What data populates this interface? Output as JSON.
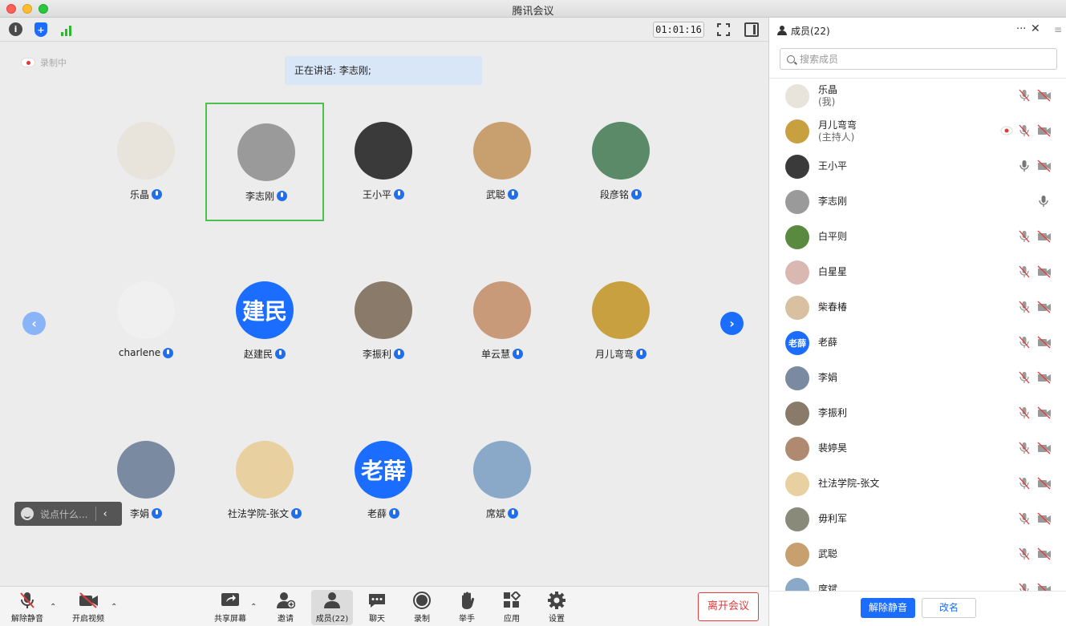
{
  "window": {
    "title": "腾讯会议"
  },
  "toolbar": {
    "timer": "01:01:16"
  },
  "recording": {
    "label": "录制中"
  },
  "speaking": {
    "text": "正在讲话: 李志刚;"
  },
  "grid": {
    "tiles": [
      {
        "name": "乐晶",
        "avatar_color": "#e8e4dc",
        "initials": ""
      },
      {
        "name": "李志刚",
        "avatar_color": "#9a9a9a",
        "initials": "",
        "active": true
      },
      {
        "name": "王小平",
        "avatar_color": "#3a3a3a",
        "initials": ""
      },
      {
        "name": "武聪",
        "avatar_color": "#c8a070",
        "initials": ""
      },
      {
        "name": "段彦铭",
        "avatar_color": "#5a8a68",
        "initials": ""
      },
      {
        "name": "charlene",
        "avatar_color": "#f0f0f0",
        "initials": ""
      },
      {
        "name": "赵建民",
        "avatar_color": "#1a6dff",
        "initials": "建民"
      },
      {
        "name": "李振利",
        "avatar_color": "#8a7a6a",
        "initials": ""
      },
      {
        "name": "单云慧",
        "avatar_color": "#c89a7a",
        "initials": ""
      },
      {
        "name": "月儿弯弯",
        "avatar_color": "#c8a040",
        "initials": ""
      },
      {
        "name": "李娟",
        "avatar_color": "#7a8aa0",
        "initials": ""
      },
      {
        "name": "社法学院-张文",
        "avatar_color": "#e8d0a0",
        "initials": ""
      },
      {
        "name": "老薛",
        "avatar_color": "#1a6dff",
        "initials": "老薛"
      },
      {
        "name": "席斌",
        "avatar_color": "#8aa8c8",
        "initials": ""
      }
    ]
  },
  "chat": {
    "placeholder": "说点什么..."
  },
  "bottombar": {
    "unmute": "解除静音",
    "video": "开启视频",
    "share": "共享屏幕",
    "invite": "邀请",
    "members": "成员(22)",
    "chat": "聊天",
    "record": "录制",
    "raise_hand": "举手",
    "apps": "应用",
    "settings": "设置",
    "leave": "离开会议"
  },
  "panel": {
    "title": "成员(22)",
    "search_placeholder": "搜索成员",
    "members": [
      {
        "name": "乐晶",
        "sub": "(我)",
        "avatar_color": "#e8e4dc",
        "mic": "muted",
        "cam": "off"
      },
      {
        "name": "月儿弯弯",
        "sub": "(主持人)",
        "avatar_color": "#c8a040",
        "mic": "muted",
        "cam": "off",
        "host_badge": true
      },
      {
        "name": "王小平",
        "sub": "",
        "avatar_color": "#3a3a3a",
        "mic": "on",
        "cam": "off"
      },
      {
        "name": "李志刚",
        "sub": "",
        "avatar_color": "#9a9a9a",
        "mic": "on",
        "cam": "none"
      },
      {
        "name": "白平则",
        "sub": "",
        "avatar_color": "#5a8a40",
        "mic": "muted",
        "cam": "off"
      },
      {
        "name": "白星星",
        "sub": "",
        "avatar_color": "#d8b8b0",
        "mic": "muted",
        "cam": "off"
      },
      {
        "name": "柴春椿",
        "sub": "",
        "avatar_color": "#d8c0a0",
        "mic": "muted",
        "cam": "off"
      },
      {
        "name": "老薛",
        "sub": "",
        "avatar_color": "#1a6dff",
        "initials": "老薛",
        "mic": "muted",
        "cam": "off"
      },
      {
        "name": "李娟",
        "sub": "",
        "avatar_color": "#7a8aa0",
        "mic": "muted",
        "cam": "off"
      },
      {
        "name": "李振利",
        "sub": "",
        "avatar_color": "#8a7a6a",
        "mic": "muted",
        "cam": "off"
      },
      {
        "name": "裴婷昊",
        "sub": "",
        "avatar_color": "#b08a70",
        "mic": "muted",
        "cam": "off"
      },
      {
        "name": "社法学院-张文",
        "sub": "",
        "avatar_color": "#e8d0a0",
        "mic": "muted",
        "cam": "off"
      },
      {
        "name": "毋利军",
        "sub": "",
        "avatar_color": "#8a8a7a",
        "mic": "muted",
        "cam": "off"
      },
      {
        "name": "武聪",
        "sub": "",
        "avatar_color": "#c8a070",
        "mic": "muted",
        "cam": "off"
      },
      {
        "name": "席斌",
        "sub": "",
        "avatar_color": "#8aa8c8",
        "mic": "muted",
        "cam": "off"
      }
    ],
    "unmute_label": "解除静音",
    "rename_label": "改名"
  },
  "colors": {
    "accent": "#1a6dff",
    "active_border": "#4dc14d",
    "leave": "#e23b3b"
  }
}
